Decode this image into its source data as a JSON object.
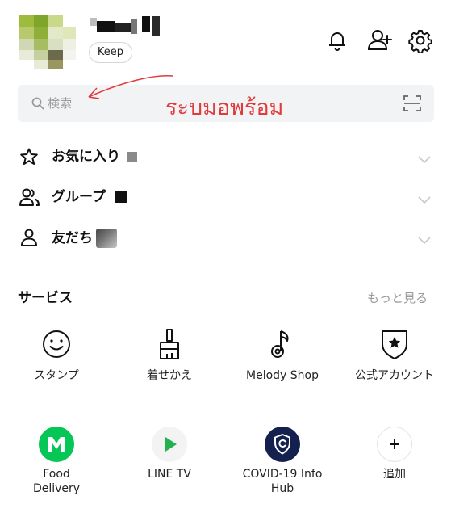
{
  "header": {
    "keep_label": "Keep"
  },
  "search": {
    "placeholder": "検索",
    "annotation": "ระบมอพร้อม"
  },
  "list": [
    {
      "label": "お気に入り",
      "icon": "star-icon"
    },
    {
      "label": "グループ",
      "icon": "group-icon"
    },
    {
      "label": "友だち",
      "icon": "person-icon"
    }
  ],
  "services": {
    "title": "サービス",
    "more_label": "もっと見る",
    "row1": [
      {
        "label": "スタンプ",
        "icon": "smiley-icon"
      },
      {
        "label": "着せかえ",
        "icon": "paintbrush-icon"
      },
      {
        "label": "Melody Shop",
        "icon": "music-note-icon"
      },
      {
        "label": "公式アカウント",
        "icon": "shield-star-icon"
      }
    ],
    "row2": [
      {
        "label": "Food Delivery",
        "icon": "line-man-icon",
        "color": "#06c755"
      },
      {
        "label": "LINE TV",
        "icon": "play-icon",
        "color": "#22b14c"
      },
      {
        "label": "COVID-19 Info Hub",
        "icon": "covid-shield-icon",
        "color": "#14214f"
      },
      {
        "label": "追加",
        "icon": "plus-icon"
      }
    ]
  },
  "colors": {
    "accent_green": "#06c755",
    "annotation_red": "#e03a3a",
    "text_gray": "#9a9a9a"
  }
}
